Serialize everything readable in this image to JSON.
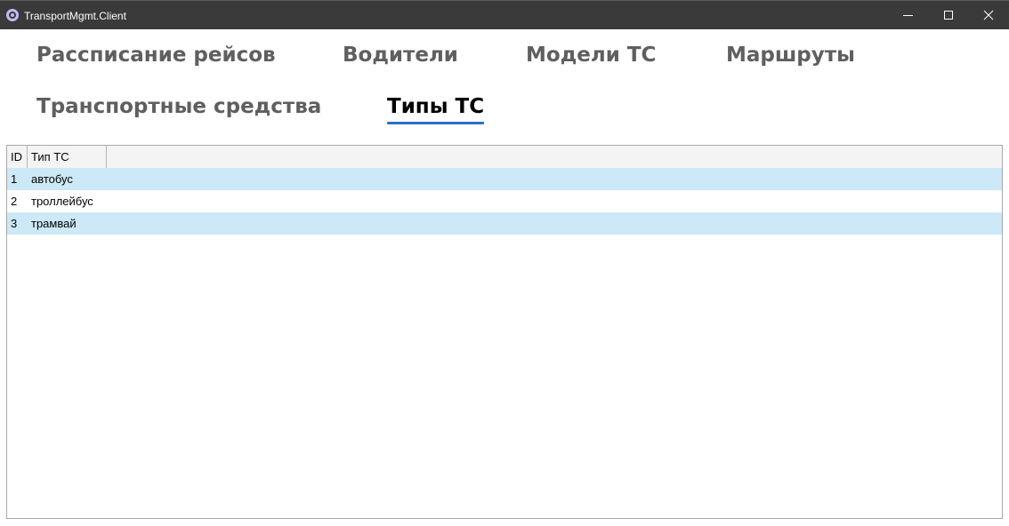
{
  "window": {
    "title": "TransportMgmt.Client",
    "icon": "app-logo-icon",
    "controls": [
      "minimize-icon",
      "maximize-icon",
      "close-icon"
    ]
  },
  "tabs": [
    {
      "label": "Рассписание рейсов",
      "active": false
    },
    {
      "label": "Водители",
      "active": false
    },
    {
      "label": "Модели ТС",
      "active": false
    },
    {
      "label": "Маршруты",
      "active": false
    },
    {
      "label": "Транспортные средства",
      "active": false
    },
    {
      "label": "Типы ТС",
      "active": true
    }
  ],
  "grid": {
    "columns": [
      "ID",
      "Тип ТС"
    ],
    "rows": [
      {
        "id": "1",
        "type": "автобус"
      },
      {
        "id": "2",
        "type": "троллейбус"
      },
      {
        "id": "3",
        "type": "трамвай"
      }
    ]
  },
  "colors": {
    "titlebar": "#3a3a3a",
    "active_tab_underline": "#2b6fc7",
    "alternate_row": "#cde8f6",
    "inactive_tab_text": "#5f5f5f"
  }
}
